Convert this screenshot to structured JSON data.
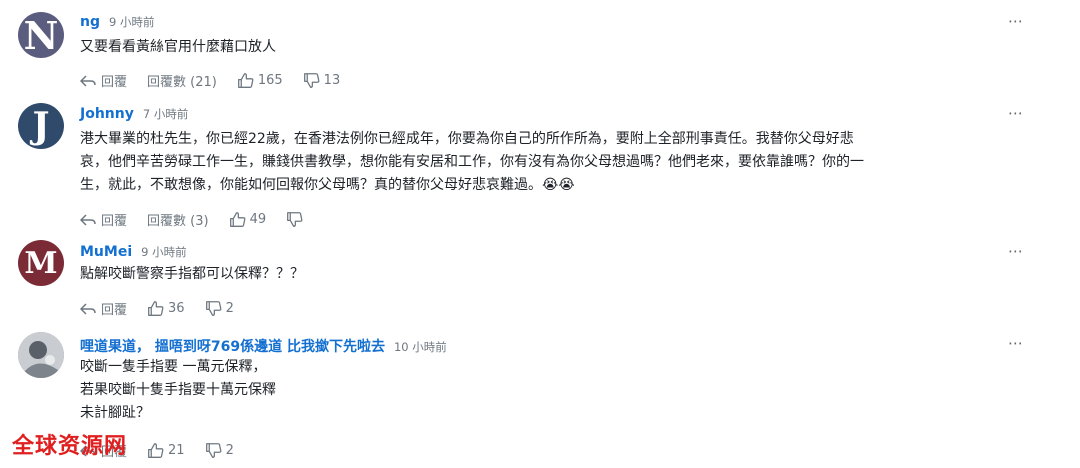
{
  "comments": [
    {
      "avatar_letter": "N",
      "user": "ng",
      "time": "9 小時前",
      "text": "又要看看黃絲官用什麼藉口放人",
      "reply_label": "回覆",
      "replies_label": "回覆數 (21)",
      "likes": "165",
      "dislikes": "13"
    },
    {
      "avatar_letter": "J",
      "user": "Johnny",
      "time": "7 小時前",
      "text": "港大畢業的杜先生，你已經22歲，在香港法例你已經成年，你要為你自己的所作所為，要附上全部刑事責任。我替你父母好悲\n哀，他們辛苦勞碌工作一生，賺錢供書教學，想你能有安居和工作，你有沒有為你父母想過嗎？他們老來，要依靠誰嗎？你的一\n生，就此，不敢想像，你能如何回報你父母嗎？真的替你父母好悲哀難過。😭😭",
      "reply_label": "回覆",
      "replies_label": "回覆數 (3)",
      "likes": "49",
      "dislikes": ""
    },
    {
      "avatar_letter": "M",
      "user": "MuMei",
      "time": "9 小時前",
      "text": "點解咬斷警察手指都可以保釋？？？",
      "reply_label": "回覆",
      "replies_label": "",
      "likes": "36",
      "dislikes": "2"
    },
    {
      "avatar_letter": "",
      "user": "哩道果道， 搵唔到呀769係邊道 比我撳下先啦去",
      "time": "10 小時前",
      "text": "咬斷一隻手指要 一萬元保釋，\n若果咬斷十隻手指要十萬元保釋\n未計腳趾？",
      "reply_label": "回覆",
      "replies_label": "",
      "likes": "21",
      "dislikes": "2"
    }
  ],
  "more_icon": "⋯",
  "watermark": "全球资源网",
  "colors": {
    "username": "#1470d0",
    "muted": "#6e7780",
    "watermark": "#e02020"
  }
}
